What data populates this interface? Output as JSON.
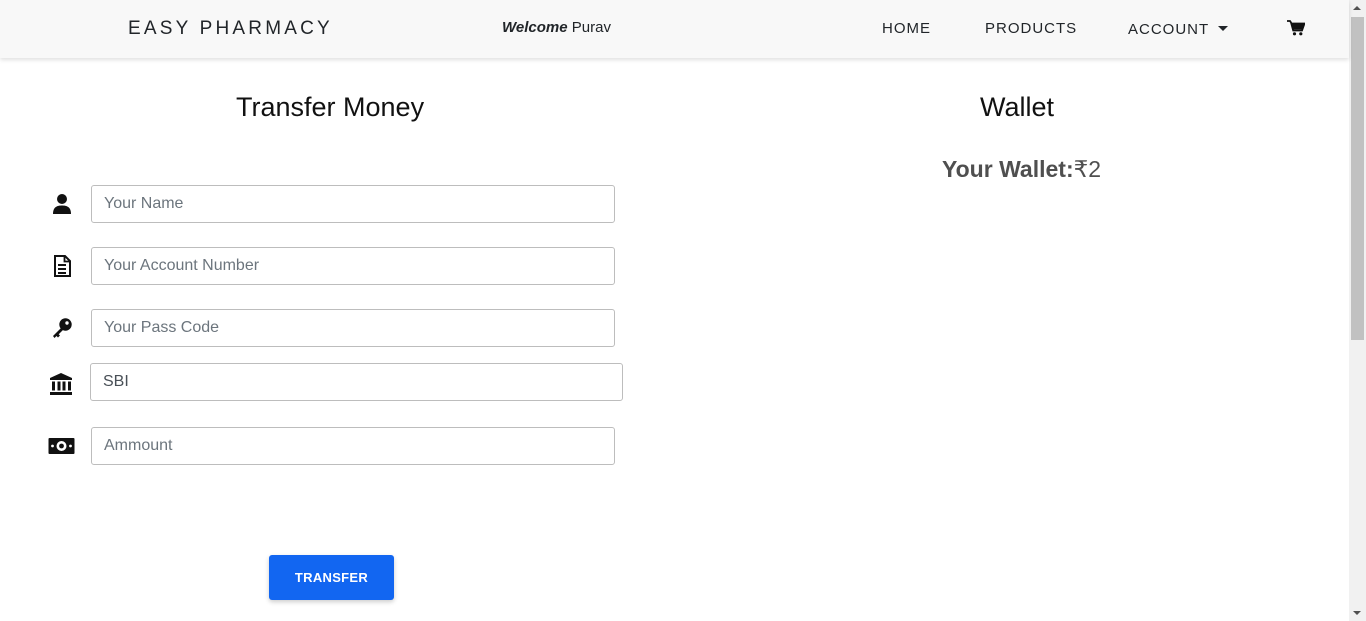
{
  "navbar": {
    "brand": "EASY PHARMACY",
    "welcome_prefix": "Welcome",
    "welcome_user": "Purav",
    "links": {
      "home": "HOME",
      "products": "PRODUCTS",
      "account": "ACCOUNT"
    },
    "cart_icon": "cart-icon"
  },
  "transfer": {
    "title": "Transfer Money",
    "fields": {
      "name": {
        "icon": "user-icon",
        "placeholder": "Your Name",
        "value": ""
      },
      "account_number": {
        "icon": "document-icon",
        "placeholder": "Your Account Number",
        "value": ""
      },
      "pass_code": {
        "icon": "key-icon",
        "placeholder": "Your Pass Code",
        "value": ""
      },
      "bank": {
        "icon": "bank-icon",
        "value": "SBI"
      },
      "amount": {
        "icon": "money-icon",
        "placeholder": "Ammount",
        "value": ""
      }
    },
    "button_label": "TRANSFER",
    "accent_color": "#1266f1"
  },
  "wallet": {
    "title": "Wallet",
    "balance_label": "Your Wallet:",
    "balance_value": "₹2"
  }
}
